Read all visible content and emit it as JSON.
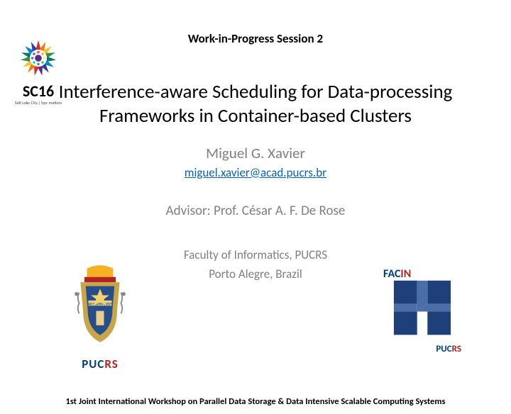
{
  "session": "Work-in-Progress Session 2",
  "title_line1": "Interference-aware Scheduling for Data-processing",
  "title_line2": "Frameworks in Container-based Clusters",
  "author": "Miguel G. Xavier",
  "email": "miguel.xavier@acad.pucrs.br",
  "advisor": "Advisor: Prof. César A. F. De Rose",
  "faculty": "Faculty of Informatics, PUCRS",
  "location": "Porto Alegre, Brazil",
  "footer": "1st Joint International Workshop on Parallel Data Storage & Data Intensive Scalable Computing Systems",
  "conference_logo": {
    "name": "SC16",
    "city": "Salt Lake City",
    "tagline": "hpc matters"
  },
  "pucrs_label": "PUCRS",
  "facin_label": "FACIN"
}
